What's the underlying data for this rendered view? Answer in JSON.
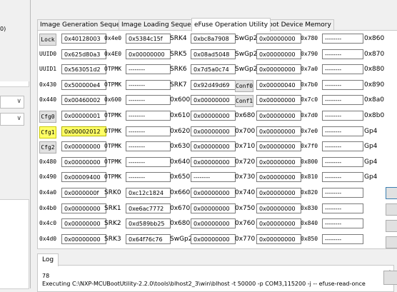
{
  "left_panel": {
    "partial_label": "0)"
  },
  "tabs": [
    {
      "label": "Image Generation Sequence",
      "active": false
    },
    {
      "label": "Image Loading Sequence",
      "active": false
    },
    {
      "label": "eFuse Operation Utility",
      "active": true
    },
    {
      "label": "Boot Device Memory",
      "active": false
    }
  ],
  "efuse": {
    "rows": [
      {
        "c1": {
          "type": "btn",
          "label": "Lock"
        },
        "v1": "0x40128003",
        "a2": "0x4e0",
        "v2": "0x5384c15f",
        "l3": "SRK4",
        "v3": "0xbc8a7908",
        "l4": "SwGp2",
        "v4": "0x00000000",
        "a5": "0x780",
        "v5": "--------",
        "a6": "0x860"
      },
      {
        "c1": {
          "type": "lbl",
          "label": "UUID0"
        },
        "v1": "0x625d80a3",
        "a2": "0x4E0",
        "v2": "0x00000000",
        "l3": "SRK5",
        "v3": "0x08ad5048",
        "l4": "SwGp2",
        "v4": "0x00000000",
        "a5": "0x790",
        "v5": "--------",
        "a6": "0x870"
      },
      {
        "c1": {
          "type": "lbl",
          "label": "UUID1"
        },
        "v1": "0x563051d2",
        "a2": "OTPMK",
        "v2": "--------",
        "l3": "SRK6",
        "v3": "0x7d5a0c74",
        "l4": "SwGp2",
        "v4": "0x00000000",
        "a5": "0x7a0",
        "v5": "--------",
        "a6": "0x880"
      },
      {
        "c1": {
          "type": "lbl",
          "label": "0x430"
        },
        "v1": "0x500000e4",
        "a2": "OTPMK",
        "v2": "--------",
        "l3": "SRK7",
        "v3": "0x92d49d69",
        "l4": "Conf0",
        "l4btn": true,
        "v4": "0x00000040",
        "a5": "0x7b0",
        "v5": "--------",
        "a6": "0x890"
      },
      {
        "c1": {
          "type": "lbl",
          "label": "0x440"
        },
        "v1": "0x00460002",
        "a2": "0x600",
        "v2": "--------",
        "l3": "0x600",
        "v3": "0x00000000",
        "l4": "Conf1",
        "l4btn": true,
        "v4": "0x00000000",
        "a5": "0x7c0",
        "v5": "--------",
        "a6": "0x8a0"
      },
      {
        "c1": {
          "type": "btn",
          "label": "Cfg0"
        },
        "v1": "0x00000001",
        "a2": "OTPMK",
        "v2": "--------",
        "l3": "0x610",
        "v3": "0x00000000",
        "l4": "0x680",
        "v4": "0x00000000",
        "a5": "0x7d0",
        "v5": "--------",
        "a6": "0x8b0"
      },
      {
        "c1": {
          "type": "btn",
          "label": "Cfg1",
          "hl": true
        },
        "v1": "0x00002012",
        "v1hl": true,
        "a2": "OTPMK",
        "v2": "--------",
        "l3": "0x620",
        "v3": "0x00000000",
        "l4": "0x700",
        "v4": "0x00000000",
        "a5": "0x7e0",
        "v5": "--------",
        "a6": "Gp4"
      },
      {
        "c1": {
          "type": "btn",
          "label": "Cfg2"
        },
        "v1": "0x00000000",
        "a2": "OTPMK",
        "v2": "--------",
        "l3": "0x630",
        "v3": "0x00000000",
        "l4": "0x710",
        "v4": "0x00000000",
        "a5": "0x7f0",
        "v5": "--------",
        "a6": "Gp4"
      },
      {
        "c1": {
          "type": "lbl",
          "label": "0x480"
        },
        "v1": "0x00000000",
        "a2": "OTPMK",
        "v2": "--------",
        "l3": "0x640",
        "v3": "0x00000000",
        "l4": "0x720",
        "v4": "0x00000000",
        "a5": "0x800",
        "v5": "--------",
        "a6": "Gp4"
      },
      {
        "c1": {
          "type": "lbl",
          "label": "0x490"
        },
        "v1": "0x00009400",
        "a2": "OTPMK",
        "v2": "--------",
        "l3": "0x650",
        "v3": "--------",
        "l4": "0x730",
        "v4": "0x00000000",
        "a5": "0x810",
        "v5": "--------",
        "a6": "Gp4"
      },
      {
        "c1": {
          "type": "lbl",
          "label": "0x4a0"
        },
        "v1": "0x0000000f",
        "a2": "SRK0",
        "a2big": true,
        "v2": "0xc12c1824",
        "l3": "0x660",
        "v3": "0x00000000",
        "l4": "0x740",
        "v4": "0x00000000",
        "a5": "0x820",
        "v5": "--------",
        "a6": ""
      },
      {
        "c1": {
          "type": "lbl",
          "label": "0x4b0"
        },
        "v1": "0x00000000",
        "a2": "SRK1",
        "a2big": true,
        "v2": "0xe6ac7772",
        "l3": "0x670",
        "v3": "0x00000000",
        "l4": "0x750",
        "v4": "0x00000000",
        "a5": "0x830",
        "v5": "--------",
        "a6": ""
      },
      {
        "c1": {
          "type": "lbl",
          "label": "0x4c0"
        },
        "v1": "0x00000000",
        "a2": "SRK2",
        "a2big": true,
        "v2": "0xd589bb25",
        "l3": "0x680",
        "v3": "0x00000000",
        "l4": "0x760",
        "v4": "0x00000000",
        "a5": "0x840",
        "v5": "--------",
        "a6": ""
      },
      {
        "c1": {
          "type": "lbl",
          "label": "0x4d0"
        },
        "v1": "0x00000000",
        "a2": "SRK3",
        "a2big": true,
        "v2": "0x64f76c76",
        "l3": "SwGp2",
        "v3": "0x00000000",
        "l4": "0x770",
        "v4": "0x00000000",
        "a5": "0x850",
        "v5": "--------",
        "a6": ""
      }
    ]
  },
  "log": {
    "tab_label": "Log",
    "lines": [
      "78",
      "Executing C:\\NXP-MCUBootUtility-2.2.0\\tools\\blhost2_3\\win\\blhost -t 50000 -p COM3,115200 -j -- efuse-read-once"
    ]
  }
}
